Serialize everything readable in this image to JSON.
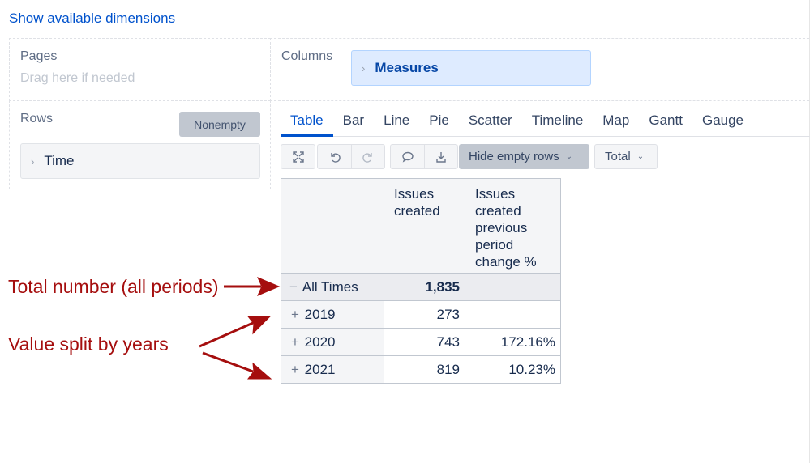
{
  "show_dimensions_link": "Show available dimensions",
  "pages": {
    "title": "Pages",
    "hint": "Drag here if needed"
  },
  "columns": {
    "title": "Columns",
    "chip": "Measures"
  },
  "rows": {
    "title": "Rows",
    "nonempty_button": "Nonempty",
    "chip": "Time"
  },
  "tabs": [
    {
      "label": "Table",
      "active": true
    },
    {
      "label": "Bar"
    },
    {
      "label": "Line"
    },
    {
      "label": "Pie"
    },
    {
      "label": "Scatter"
    },
    {
      "label": "Timeline"
    },
    {
      "label": "Map"
    },
    {
      "label": "Gantt"
    },
    {
      "label": "Gauge"
    }
  ],
  "toolbar": {
    "icons": [
      "fullscreen-icon",
      "undo-icon",
      "redo-icon",
      "comment-icon",
      "export-icon"
    ],
    "hide_empty_rows": "Hide empty rows",
    "total": "Total"
  },
  "table": {
    "headers": [
      "",
      "Issues\ncreated",
      "Issues\ncreated\nprevious\nperiod\nchange %"
    ],
    "header_col1_lines": [
      "Issues",
      "created"
    ],
    "header_col2_lines": [
      "Issues",
      "created",
      "previous",
      "period",
      "change %"
    ],
    "rows": [
      {
        "sign": "−",
        "label": "All Times",
        "issues_created": "1,835",
        "change": ""
      },
      {
        "sign": "+",
        "label": "2019",
        "issues_created": "273",
        "change": ""
      },
      {
        "sign": "+",
        "label": "2020",
        "issues_created": "743",
        "change": "172.16%"
      },
      {
        "sign": "+",
        "label": "2021",
        "issues_created": "819",
        "change": "10.23%"
      }
    ]
  },
  "annotations": {
    "total": "Total number (all periods)",
    "split": "Value split by years",
    "color": "#a50e0e"
  }
}
